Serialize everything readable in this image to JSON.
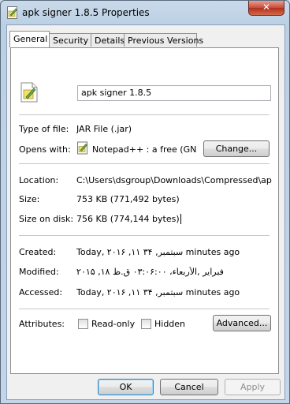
{
  "window": {
    "title": "apk signer 1.8.5 Properties",
    "close_glyph": "✕"
  },
  "tabs": [
    {
      "label": "General"
    },
    {
      "label": "Security"
    },
    {
      "label": "Details"
    },
    {
      "label": "Previous Versions"
    }
  ],
  "file": {
    "name": "apk signer 1.8.5",
    "type_label": "Type of file:",
    "type_value": "JAR File (.jar)",
    "opens_label": "Opens with:",
    "opens_value": "Notepad++ : a free (GN",
    "change_label": "Change...",
    "location_label": "Location:",
    "location_value": "C:\\Users\\dsgroup\\Downloads\\Compressed\\apk signer",
    "size_label": "Size:",
    "size_value": "753 KB (771,492 bytes)",
    "size_disk_label": "Size on disk:",
    "size_disk_value": "756 KB (774,144 bytes)",
    "created_label": "Created:",
    "created_value": "Today, ۲۰۱۶ ,۱۱ سبتمبر, ۳۴ minutes ago",
    "modified_label": "Modified:",
    "modified_value": "۲۰۱۵ ,۱۸ فبراير ,الأربعاء، ۰۳:۰۶:۰۰ ق.ظ",
    "accessed_label": "Accessed:",
    "accessed_value": "Today, ۲۰۱۶ ,۱۱ سبتمبر, ۳۴ minutes ago",
    "attributes_label": "Attributes:",
    "readonly_label": "Read-only",
    "readonly_checked": false,
    "hidden_label": "Hidden",
    "hidden_checked": false,
    "advanced_label": "Advanced..."
  },
  "footer": {
    "ok_label": "OK",
    "cancel_label": "Cancel",
    "apply_label": "Apply"
  },
  "colors": {
    "accent": "#3c7fb1",
    "close_red": "#c74a38"
  }
}
